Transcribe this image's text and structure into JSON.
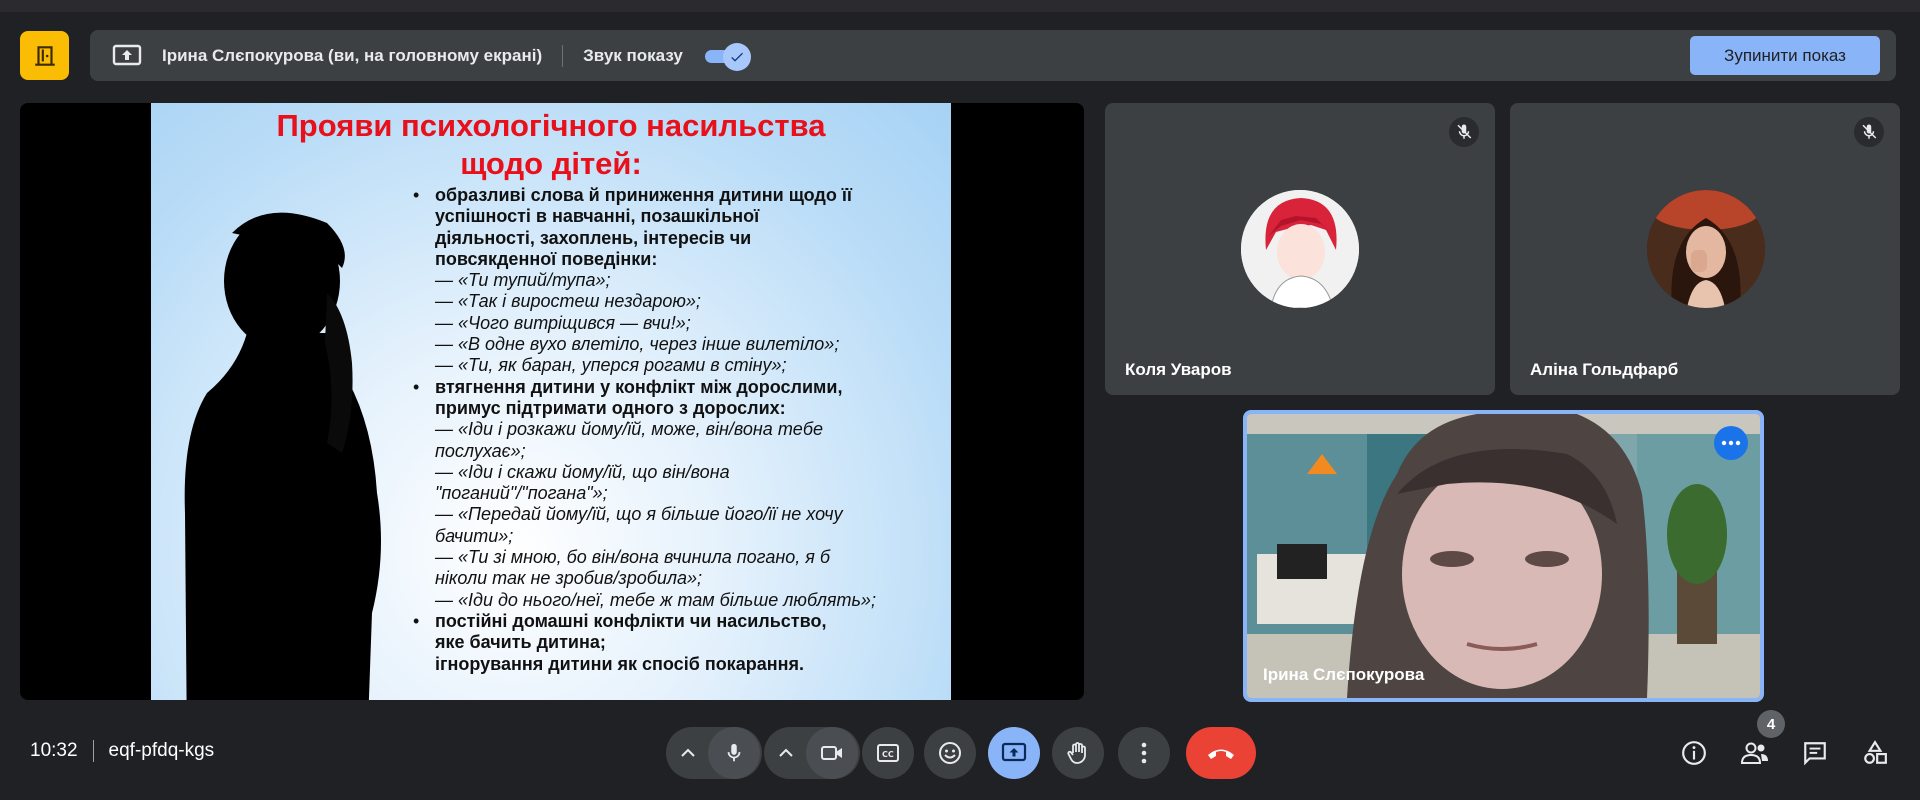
{
  "presenting_bar": {
    "presenter_label": "Ірина Слєпокурова (ви, на головному екрані)",
    "sound_label": "Звук показу",
    "sound_enabled": true,
    "stop_button": "Зупинити показ"
  },
  "slide": {
    "title_line1": "Прояви психологічного насильства",
    "title_line2": "щодо дітей:",
    "lines": [
      {
        "kind": "bullet",
        "text": "образливі слова й приниження дитини щодо її"
      },
      {
        "kind": "plain",
        "text": "успішності в навчанні, позашкільної"
      },
      {
        "kind": "plain",
        "text": "діяльності, захоплень, інтересів чи"
      },
      {
        "kind": "plain",
        "text": "повсякденної поведінки:"
      },
      {
        "kind": "quote",
        "text": "— «Ти тупий/тупа»;"
      },
      {
        "kind": "quote",
        "text": "— «Так і виростеш нездарою»;"
      },
      {
        "kind": "quote",
        "text": "— «Чого витріщився — вчи!»;"
      },
      {
        "kind": "quote",
        "text": "— «В одне вухо влетіло, через інше вилетіло»;"
      },
      {
        "kind": "quote",
        "text": "— «Ти, як баран, уперся рогами в стіну»;"
      },
      {
        "kind": "bullet",
        "text": "втягнення дитини у конфлікт між дорослими,"
      },
      {
        "kind": "plain",
        "text": "примус підтримати одного з дорослих:"
      },
      {
        "kind": "quote",
        "text": "— «Іди і розкажи йому/їй, може, він/вона тебе"
      },
      {
        "kind": "quote",
        "text": "послухає»;"
      },
      {
        "kind": "quote",
        "text": "— «Іди і скажи йому/їй, що він/вона"
      },
      {
        "kind": "quote",
        "text": "\"поганий\"/\"погана\"»;"
      },
      {
        "kind": "quote",
        "text": "— «Передай йому/їй, що я більше його/її не хочу"
      },
      {
        "kind": "quote",
        "text": "бачити»;"
      },
      {
        "kind": "quote",
        "text": "— «Ти зі мною, бо він/вона вчинила погано, я б"
      },
      {
        "kind": "quote",
        "text": "ніколи так не зробив/зробила»;"
      },
      {
        "kind": "quote",
        "text": "— «Іди до нього/неї, тебе ж там більше люблять»;"
      },
      {
        "kind": "bullet",
        "text": "постійні домашні конфлікти чи насильство,"
      },
      {
        "kind": "plain",
        "text": "яке бачить дитина;"
      },
      {
        "kind": "plain",
        "text": "ігнорування дитини як спосіб покарання."
      }
    ]
  },
  "participants": {
    "p1": {
      "name": "Коля Уваров",
      "muted": true
    },
    "p2": {
      "name": "Аліна Гольдфарб",
      "muted": true
    },
    "self": {
      "name": "Ірина Слєпокурова"
    }
  },
  "meeting": {
    "time": "10:32",
    "code": "eqf-pfdq-kgs",
    "people_count": "4"
  },
  "colors": {
    "accent": "#8ab4f8",
    "end_call": "#ea4335",
    "leave_door": "#fbbc04",
    "slide_title": "#e8101b"
  },
  "icons": [
    "door-icon",
    "present-screen-icon",
    "check-icon",
    "share-icon",
    "mic-off-icon",
    "more-dots-icon",
    "chevron-up-icon",
    "mic-icon",
    "camera-icon",
    "captions-icon",
    "emoji-icon",
    "present-icon",
    "raise-hand-icon",
    "more-vert-icon",
    "end-call-icon",
    "info-icon",
    "people-icon",
    "chat-icon",
    "activities-icon"
  ]
}
